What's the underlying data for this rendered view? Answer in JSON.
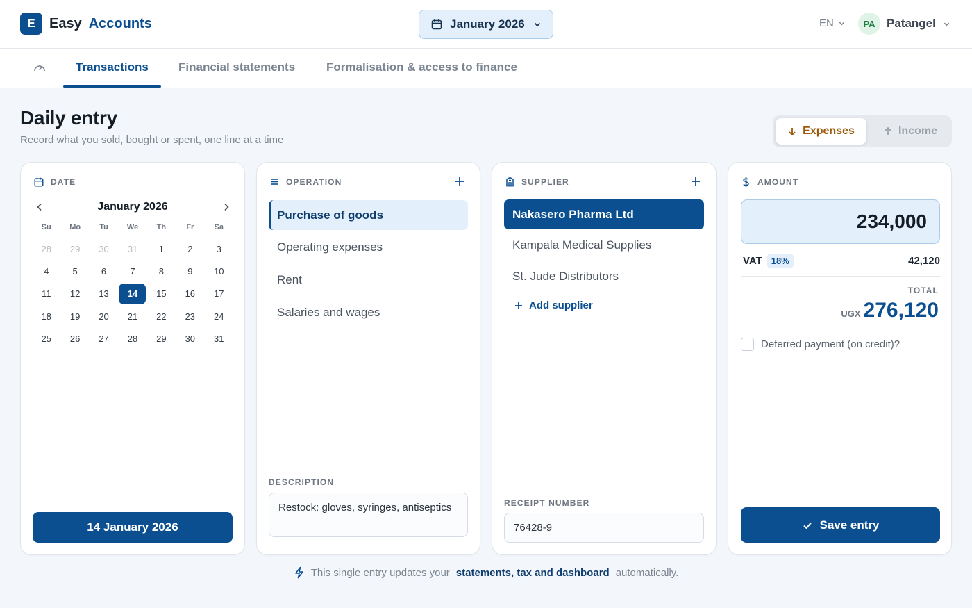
{
  "app": {
    "logo_letter": "E",
    "name_part1": "Easy",
    "name_part2": "Accounts"
  },
  "header": {
    "period": "January 2026",
    "language": "EN",
    "user_initials": "PA",
    "user_name": "Patangel"
  },
  "tabs": [
    {
      "label": "Transactions",
      "active": true
    },
    {
      "label": "Financial statements",
      "active": false
    },
    {
      "label": "Formalisation & access to finance",
      "active": false
    }
  ],
  "page": {
    "title": "Daily entry",
    "subtitle": "Record what you sold, bought or spent, one line at a time"
  },
  "mode_toggle": {
    "expenses": "Expenses",
    "income": "Income",
    "selected": "Expenses"
  },
  "date_card": {
    "header": "DATE",
    "month_label": "January 2026",
    "weekdays": [
      "Su",
      "Mo",
      "Tu",
      "We",
      "Th",
      "Fr",
      "Sa"
    ],
    "weeks": [
      [
        "28",
        "29",
        "30",
        "31",
        "1",
        "2",
        "3"
      ],
      [
        "4",
        "5",
        "6",
        "7",
        "8",
        "9",
        "10"
      ],
      [
        "11",
        "12",
        "13",
        "14",
        "15",
        "16",
        "17"
      ],
      [
        "18",
        "19",
        "20",
        "21",
        "22",
        "23",
        "24"
      ],
      [
        "25",
        "26",
        "27",
        "28",
        "29",
        "30",
        "31"
      ]
    ],
    "selected_day": "14",
    "selected_label": "14 January 2026"
  },
  "operation_card": {
    "header": "OPERATION",
    "options": [
      "Purchase of goods",
      "Operating expenses",
      "Rent",
      "Salaries and wages"
    ],
    "selected": "Purchase of goods",
    "description_label": "DESCRIPTION",
    "description_value": "Restock: gloves, syringes, antiseptics"
  },
  "supplier_card": {
    "header": "SUPPLIER",
    "options": [
      "Nakasero Pharma Ltd",
      "Kampala Medical Supplies",
      "St. Jude Distributors"
    ],
    "selected": "Nakasero Pharma Ltd",
    "add_label": "Add supplier",
    "receipt_label": "RECEIPT NUMBER",
    "receipt_value": "76428-9"
  },
  "amount_card": {
    "header": "AMOUNT",
    "amount": "234,000",
    "vat_label": "VAT",
    "vat_rate": "18%",
    "vat_value": "42,120",
    "total_label": "TOTAL",
    "currency": "UGX",
    "total_value": "276,120",
    "deferred_label": "Deferred payment (on credit)?",
    "save_label": "Save entry"
  },
  "footer": {
    "prefix": "This single entry updates your",
    "highlight": "statements, tax and dashboard",
    "suffix": "automatically."
  },
  "colors": {
    "primary": "#0b4f91",
    "expense_accent": "#9a5a0c",
    "background": "#f3f7fb"
  }
}
